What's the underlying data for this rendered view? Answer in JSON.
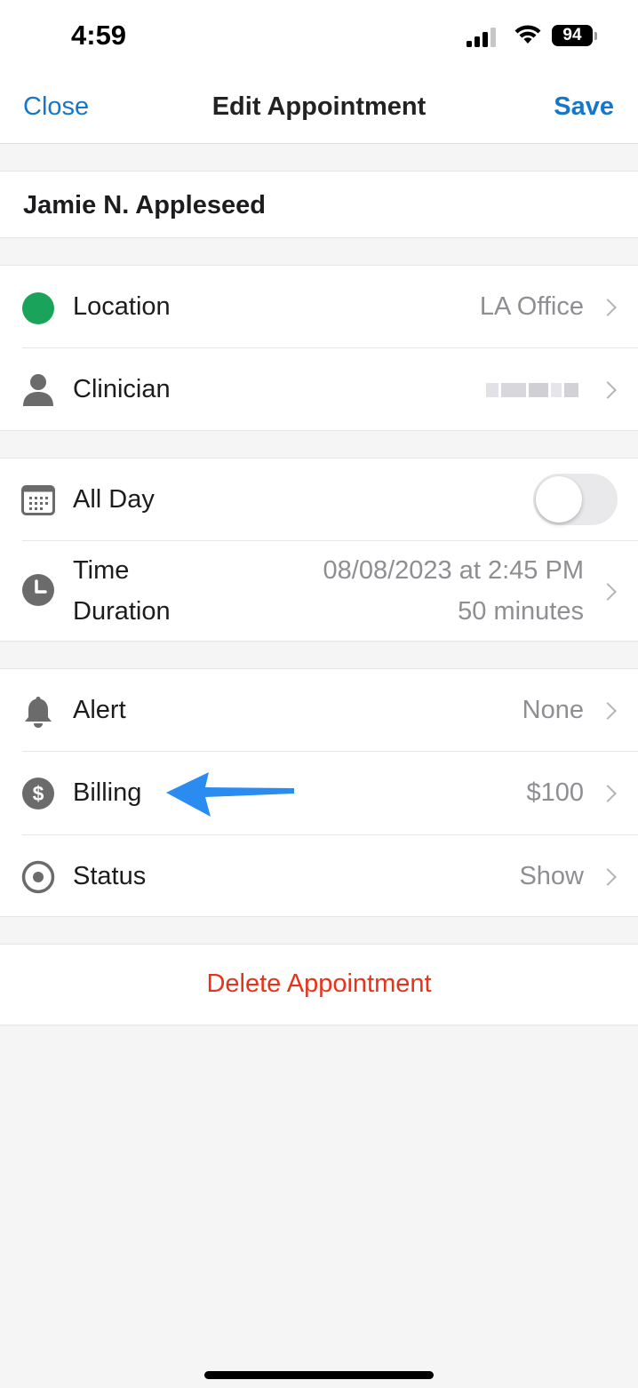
{
  "status_bar": {
    "time": "4:59",
    "battery": "94",
    "icons": [
      "signal-icon",
      "wifi-icon",
      "battery-icon"
    ]
  },
  "nav": {
    "close_label": "Close",
    "title": "Edit Appointment",
    "save_label": "Save"
  },
  "patient": {
    "name": "Jamie N. Appleseed"
  },
  "location": {
    "label": "Location",
    "value": "LA Office",
    "dot_color": "#1aa35a"
  },
  "clinician": {
    "label": "Clinician",
    "value_redacted": true
  },
  "all_day": {
    "label": "All Day",
    "enabled": false
  },
  "time": {
    "label": "Time",
    "value": "08/08/2023 at 2:45 PM",
    "duration_label": "Duration",
    "duration_value": "50 minutes"
  },
  "alert": {
    "label": "Alert",
    "value": "None"
  },
  "billing": {
    "label": "Billing",
    "value": "$100"
  },
  "status": {
    "label": "Status",
    "value": "Show"
  },
  "delete": {
    "label": "Delete Appointment",
    "color": "#e5341b"
  },
  "colors": {
    "accent": "#1677c9",
    "annotation_arrow": "#2a8cf0",
    "secondary_text": "#8e8e93",
    "icon_gray": "#6b6b6b"
  }
}
